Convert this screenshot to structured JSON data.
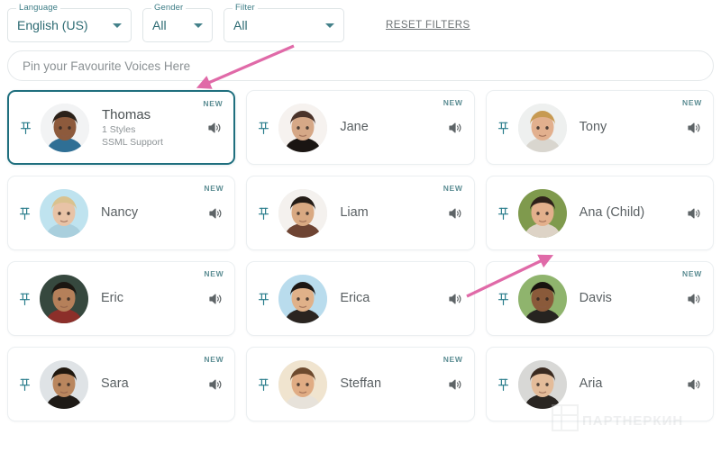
{
  "filters": {
    "language": {
      "label": "Language",
      "value": "English (US)"
    },
    "gender": {
      "label": "Gender",
      "value": "All"
    },
    "filter": {
      "label": "Filter",
      "value": "All"
    },
    "reset_label": "RESET FILTERS"
  },
  "pin_bar": {
    "placeholder": "Pin your Favourite Voices Here"
  },
  "labels": {
    "new_badge": "NEW"
  },
  "watermark": {
    "text": "ПАРТНЕРКИН"
  },
  "colors": {
    "accent_teal": "#2a7d8c",
    "selected_border": "#1f6f7e",
    "badge_new": "#5c8d93",
    "arrow_pink": "#e濃"
  },
  "voices": [
    {
      "name": "Thomas",
      "styles": "1 Styles",
      "ssml": "SSML Support",
      "new": true,
      "selected": true,
      "pin": "pin-icon",
      "speaker": "speaker-icon",
      "avatar": {
        "skin": "#8d5a3c",
        "hair": "#2b2119",
        "bg": "#f2f3f4",
        "shirt": "#2f6f95"
      }
    },
    {
      "name": "Jane",
      "styles": "",
      "ssml": "",
      "new": true,
      "selected": false,
      "pin": "pin-icon",
      "speaker": "speaker-icon",
      "avatar": {
        "skin": "#d6a887",
        "hair": "#4a332a",
        "bg": "#f6f2ef",
        "shirt": "#1a1512"
      }
    },
    {
      "name": "Tony",
      "styles": "",
      "ssml": "",
      "new": true,
      "selected": false,
      "pin": "pin-icon",
      "speaker": "speaker-icon",
      "avatar": {
        "skin": "#e2b08e",
        "hair": "#c79a52",
        "bg": "#eef0ef",
        "shirt": "#d9d6cf"
      }
    },
    {
      "name": "Nancy",
      "styles": "",
      "ssml": "",
      "new": true,
      "selected": false,
      "pin": "pin-icon",
      "speaker": "speaker-icon",
      "avatar": {
        "skin": "#e8c3a6",
        "hair": "#d9c28f",
        "bg": "#bfe3ef",
        "shirt": "#a9cfdd"
      }
    },
    {
      "name": "Liam",
      "styles": "",
      "ssml": "",
      "new": true,
      "selected": false,
      "pin": "pin-icon",
      "speaker": "speaker-icon",
      "avatar": {
        "skin": "#d9a982",
        "hair": "#241c16",
        "bg": "#f4f1ee",
        "shirt": "#6e4433"
      }
    },
    {
      "name": "Ana (Child)",
      "styles": "",
      "ssml": "",
      "new": false,
      "selected": false,
      "pin": "pin-icon",
      "speaker": "speaker-icon",
      "avatar": {
        "skin": "#e3b08c",
        "hair": "#2e211a",
        "bg": "#7f9a4d",
        "shirt": "#ddd3c6"
      }
    },
    {
      "name": "Eric",
      "styles": "",
      "ssml": "",
      "new": true,
      "selected": false,
      "pin": "pin-icon",
      "speaker": "speaker-icon",
      "avatar": {
        "skin": "#b5805a",
        "hair": "#1c1712",
        "bg": "#36483e",
        "shirt": "#8c2f2a"
      }
    },
    {
      "name": "Erica",
      "styles": "",
      "ssml": "",
      "new": false,
      "selected": false,
      "pin": "pin-icon",
      "speaker": "speaker-icon",
      "avatar": {
        "skin": "#e0b189",
        "hair": "#1d1714",
        "bg": "#b9dced",
        "shirt": "#2a2420"
      }
    },
    {
      "name": "Davis",
      "styles": "",
      "ssml": "",
      "new": true,
      "selected": false,
      "pin": "pin-icon",
      "speaker": "speaker-icon",
      "avatar": {
        "skin": "#8a5a3a",
        "hair": "#19140f",
        "bg": "#8fb46d",
        "shirt": "#262320"
      }
    },
    {
      "name": "Sara",
      "styles": "",
      "ssml": "",
      "new": true,
      "selected": false,
      "pin": "pin-icon",
      "speaker": "speaker-icon",
      "avatar": {
        "skin": "#b9865e",
        "hair": "#20180f",
        "bg": "#dfe3e6",
        "shirt": "#1e1a16"
      }
    },
    {
      "name": "Steffan",
      "styles": "",
      "ssml": "",
      "new": true,
      "selected": false,
      "pin": "pin-icon",
      "speaker": "speaker-icon",
      "avatar": {
        "skin": "#e0ac84",
        "hair": "#6d4a2e",
        "bg": "#f0e4cf",
        "shirt": "#e7e2da"
      }
    },
    {
      "name": "Aria",
      "styles": "",
      "ssml": "",
      "new": false,
      "selected": false,
      "pin": "pin-icon",
      "speaker": "speaker-icon",
      "avatar": {
        "skin": "#e4bc9a",
        "hair": "#3a2a20",
        "bg": "#d8d8d6",
        "shirt": "#2a2622"
      }
    }
  ]
}
